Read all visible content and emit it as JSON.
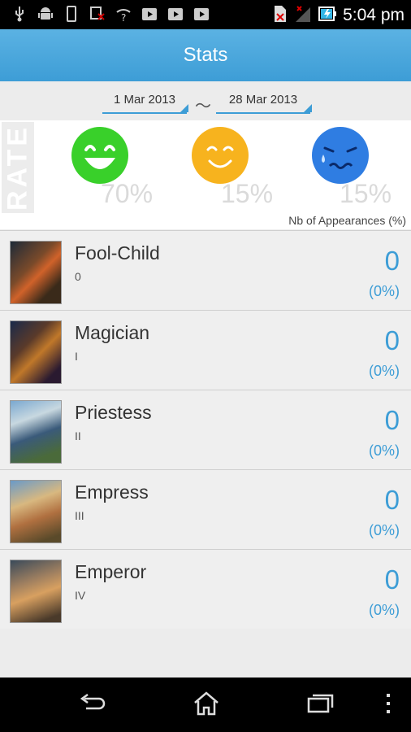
{
  "status_bar": {
    "time": "5:04 pm",
    "icons_left": [
      "usb-icon",
      "android-icon",
      "phone-icon",
      "no-signal-icon",
      "wifi-help-icon",
      "play-store-icon",
      "play-store-icon",
      "play-store-icon"
    ],
    "icons_right": [
      "no-sim-icon",
      "signal-icon",
      "battery-charging-icon"
    ]
  },
  "action_bar": {
    "title": "Stats"
  },
  "date_range": {
    "from": "1 Mar 2013",
    "separator": "〜",
    "to": "28 Mar 2013"
  },
  "rate": {
    "label": "RATE",
    "faces": [
      {
        "mood": "happy",
        "color": "#39d02a",
        "percent": "70%"
      },
      {
        "mood": "content",
        "color": "#f7b31e",
        "percent": "15%"
      },
      {
        "mood": "sad",
        "color": "#2f7de2",
        "percent": "15%"
      }
    ],
    "caption": "Nb of Appearances (%)"
  },
  "cards": [
    {
      "name": "Fool-Child",
      "numeral": "0",
      "count": "0",
      "percent": "(0%)"
    },
    {
      "name": "Magician",
      "numeral": "I",
      "count": "0",
      "percent": "(0%)"
    },
    {
      "name": "Priestess",
      "numeral": "II",
      "count": "0",
      "percent": "(0%)"
    },
    {
      "name": "Empress",
      "numeral": "III",
      "count": "0",
      "percent": "(0%)"
    },
    {
      "name": "Emperor",
      "numeral": "IV",
      "count": "0",
      "percent": "(0%)"
    }
  ],
  "nav_bar": {
    "buttons": [
      "back-icon",
      "home-icon",
      "recent-apps-icon",
      "menu-icon"
    ]
  }
}
